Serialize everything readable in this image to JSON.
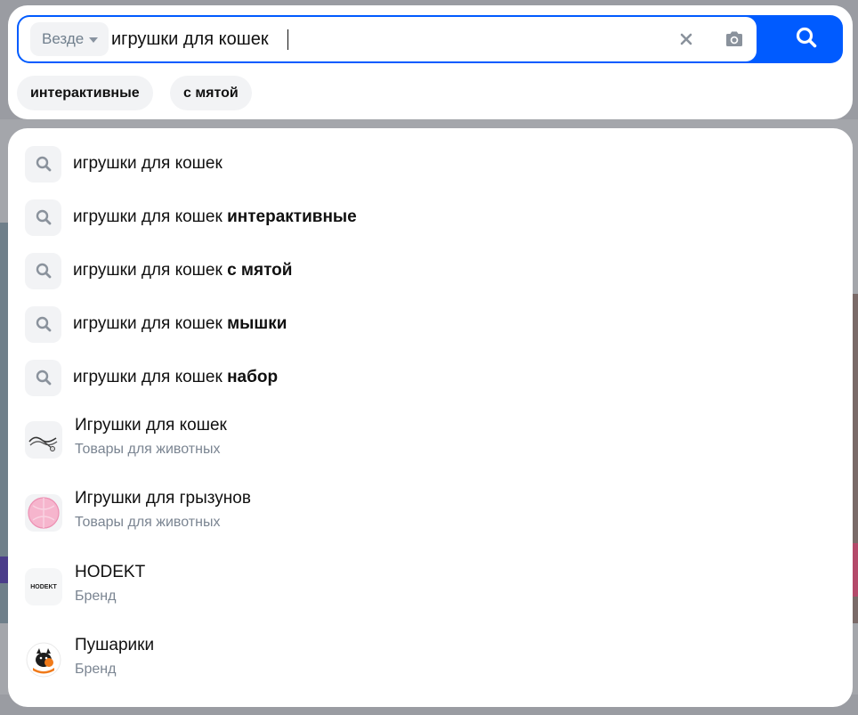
{
  "search": {
    "scope_label": "Везде",
    "query": "игрушки для кошек",
    "placeholder": ""
  },
  "chips": [
    {
      "label": "интерактивные"
    },
    {
      "label": "с мятой"
    }
  ],
  "query_suggestions": [
    {
      "base": "игрушки для кошек",
      "bold": ""
    },
    {
      "base": "игрушки для кошек ",
      "bold": "интерактивные"
    },
    {
      "base": "игрушки для кошек ",
      "bold": "с мятой"
    },
    {
      "base": "игрушки для кошек ",
      "bold": "мышки"
    },
    {
      "base": "игрушки для кошек ",
      "bold": "набор"
    }
  ],
  "rich_suggestions": [
    {
      "title": "Игрушки для кошек",
      "subtitle": "Товары для животных",
      "thumb": "cat-teaser-toy-image"
    },
    {
      "title": "Игрушки для грызунов",
      "subtitle": "Товары для животных",
      "thumb": "pink-hamster-ball-image"
    },
    {
      "title": "HODEKT",
      "subtitle": "Бренд",
      "thumb": "hodekt-logo",
      "logo_text": "HODEKT"
    },
    {
      "title": "Пушарики",
      "subtitle": "Бренд",
      "thumb": "pusharik-logo"
    }
  ],
  "colors": {
    "accent": "#005bff",
    "chip_bg": "#f2f3f5",
    "secondary_text": "#7b8592"
  }
}
